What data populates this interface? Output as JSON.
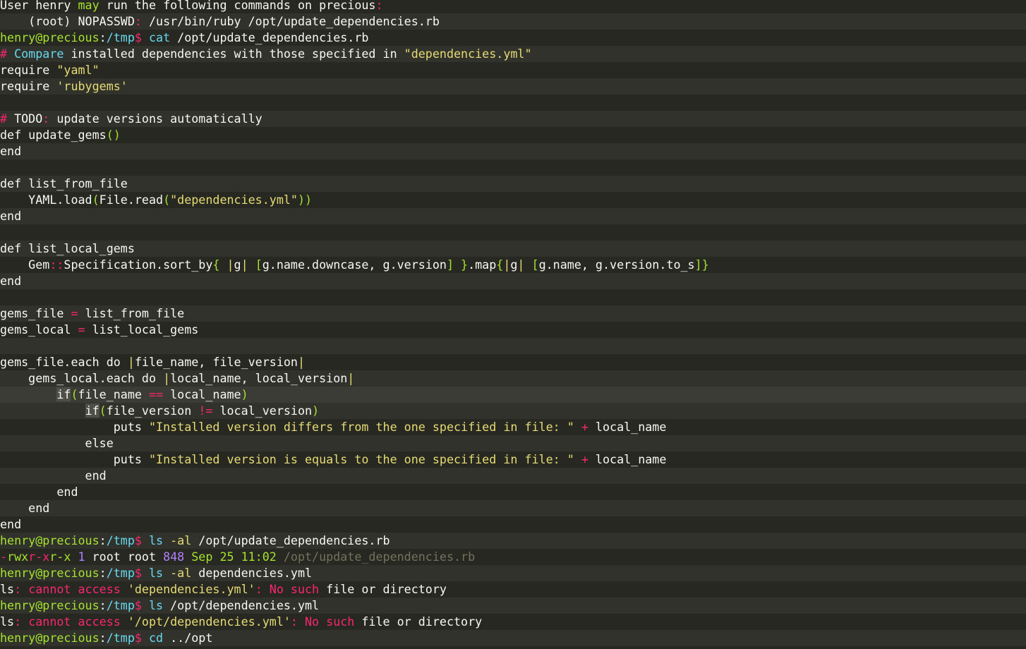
{
  "terminal": {
    "lines": [
      {
        "name": "sudo-l-header",
        "segs": [
          [
            "d",
            "User henry "
          ],
          [
            "g",
            "may"
          ],
          [
            "d",
            " run the following commands on precious"
          ],
          [
            "k",
            ":"
          ]
        ]
      },
      {
        "name": "sudo-l-entry",
        "segs": [
          [
            "d",
            "    (root) NOPASSWD"
          ],
          [
            "k",
            ":"
          ],
          [
            "d",
            " /usr/bin/ruby /opt/update_dependencies.rb"
          ]
        ]
      },
      {
        "name": "prompt-cat",
        "segs": [
          [
            "g",
            "henry@precious"
          ],
          [
            "d",
            ":"
          ],
          [
            "b",
            "/tmp"
          ],
          [
            "k",
            "$"
          ],
          [
            "d",
            " "
          ],
          [
            "b",
            "cat"
          ],
          [
            "d",
            " /opt/update_dependencies.rb"
          ]
        ]
      },
      {
        "name": "code-comment",
        "segs": [
          [
            "k",
            "#"
          ],
          [
            "d",
            " "
          ],
          [
            "b",
            "Compare"
          ],
          [
            "d",
            " installed dependencies with those specified in "
          ],
          [
            "y",
            "\"dependencies.yml\""
          ]
        ]
      },
      {
        "name": "code-require-yaml",
        "segs": [
          [
            "d",
            "require "
          ],
          [
            "y",
            "\"yaml\""
          ]
        ]
      },
      {
        "name": "code-require-rubygems",
        "segs": [
          [
            "d",
            "require "
          ],
          [
            "y",
            "'rubygems'"
          ]
        ]
      },
      {
        "name": "blank",
        "segs": []
      },
      {
        "name": "code-todo",
        "segs": [
          [
            "k",
            "#"
          ],
          [
            "d",
            " TODO"
          ],
          [
            "k",
            ":"
          ],
          [
            "d",
            " update versions automatically"
          ]
        ]
      },
      {
        "name": "code-def-update-gems",
        "segs": [
          [
            "d",
            "def update_gems"
          ],
          [
            "g",
            "()"
          ]
        ]
      },
      {
        "name": "code-end",
        "segs": [
          [
            "d",
            "end"
          ]
        ]
      },
      {
        "name": "blank",
        "segs": []
      },
      {
        "name": "code-def-list-from-file",
        "segs": [
          [
            "d",
            "def list_from_file"
          ]
        ]
      },
      {
        "name": "code-yaml-load",
        "segs": [
          [
            "d",
            "    YAML.load"
          ],
          [
            "g",
            "("
          ],
          [
            "d",
            "File.read"
          ],
          [
            "g",
            "("
          ],
          [
            "y",
            "\"dependencies.yml\""
          ],
          [
            "g",
            "))"
          ]
        ]
      },
      {
        "name": "code-end",
        "segs": [
          [
            "d",
            "end"
          ]
        ]
      },
      {
        "name": "blank",
        "segs": []
      },
      {
        "name": "code-def-list-local-gems",
        "segs": [
          [
            "d",
            "def list_local_gems"
          ]
        ]
      },
      {
        "name": "code-gem-spec",
        "segs": [
          [
            "d",
            "    Gem"
          ],
          [
            "k",
            "::"
          ],
          [
            "d",
            "Specification.sort_by"
          ],
          [
            "g",
            "{"
          ],
          [
            "d",
            " "
          ],
          [
            "y",
            "|"
          ],
          [
            "d",
            "g"
          ],
          [
            "y",
            "|"
          ],
          [
            "d",
            " "
          ],
          [
            "g",
            "["
          ],
          [
            "d",
            "g.name.downcase, g.version"
          ],
          [
            "g",
            "]"
          ],
          [
            "d",
            " "
          ],
          [
            "g",
            "}"
          ],
          [
            "d",
            ".map"
          ],
          [
            "g",
            "{"
          ],
          [
            "y",
            "|"
          ],
          [
            "d",
            "g"
          ],
          [
            "y",
            "|"
          ],
          [
            "d",
            " "
          ],
          [
            "g",
            "["
          ],
          [
            "d",
            "g.name, g.version.to_s"
          ],
          [
            "g",
            "]}"
          ]
        ]
      },
      {
        "name": "code-end",
        "segs": [
          [
            "d",
            "end"
          ]
        ]
      },
      {
        "name": "blank",
        "segs": []
      },
      {
        "name": "code-gems-file",
        "segs": [
          [
            "d",
            "gems_file "
          ],
          [
            "k",
            "="
          ],
          [
            "d",
            " list_from_file"
          ]
        ]
      },
      {
        "name": "code-gems-local",
        "segs": [
          [
            "d",
            "gems_local "
          ],
          [
            "k",
            "="
          ],
          [
            "d",
            " list_local_gems"
          ]
        ]
      },
      {
        "name": "blank",
        "segs": []
      },
      {
        "name": "code-each-file",
        "segs": [
          [
            "d",
            "gems_file.each do "
          ],
          [
            "y",
            "|"
          ],
          [
            "d",
            "file_name, file_version"
          ],
          [
            "y",
            "|"
          ]
        ]
      },
      {
        "name": "code-each-local",
        "segs": [
          [
            "d",
            "    gems_local.each do "
          ],
          [
            "y",
            "|"
          ],
          [
            "d",
            "local_name, local_version"
          ],
          [
            "y",
            "|"
          ]
        ]
      },
      {
        "name": "code-if-name",
        "cursor": true,
        "segs": [
          [
            "d",
            "        "
          ],
          [
            "hl",
            "if"
          ],
          [
            "g",
            "("
          ],
          [
            "d",
            "file_name "
          ],
          [
            "k",
            "=="
          ],
          [
            "d",
            " local_name"
          ],
          [
            "g",
            ")"
          ]
        ]
      },
      {
        "name": "code-if-version",
        "segs": [
          [
            "d",
            "            "
          ],
          [
            "hl",
            "if"
          ],
          [
            "g",
            "("
          ],
          [
            "d",
            "file_version "
          ],
          [
            "k",
            "!="
          ],
          [
            "d",
            " local_version"
          ],
          [
            "g",
            ")"
          ]
        ]
      },
      {
        "name": "code-puts-differs",
        "segs": [
          [
            "d",
            "                puts "
          ],
          [
            "y",
            "\"Installed version differs from the one specified in file: \""
          ],
          [
            "d",
            " "
          ],
          [
            "k",
            "+"
          ],
          [
            "d",
            " local_name"
          ]
        ]
      },
      {
        "name": "code-else",
        "segs": [
          [
            "d",
            "            else"
          ]
        ]
      },
      {
        "name": "code-puts-equals",
        "segs": [
          [
            "d",
            "                puts "
          ],
          [
            "y",
            "\"Installed version is equals to the one specified in file: \""
          ],
          [
            "d",
            " "
          ],
          [
            "k",
            "+"
          ],
          [
            "d",
            " local_name"
          ]
        ]
      },
      {
        "name": "code-end",
        "segs": [
          [
            "d",
            "            end"
          ]
        ]
      },
      {
        "name": "code-end",
        "segs": [
          [
            "d",
            "        end"
          ]
        ]
      },
      {
        "name": "code-end",
        "segs": [
          [
            "d",
            "    end"
          ]
        ]
      },
      {
        "name": "code-end",
        "segs": [
          [
            "d",
            "end"
          ]
        ]
      },
      {
        "name": "prompt-ls-script",
        "segs": [
          [
            "g",
            "henry@precious"
          ],
          [
            "d",
            ":"
          ],
          [
            "b",
            "/tmp"
          ],
          [
            "k",
            "$"
          ],
          [
            "d",
            " "
          ],
          [
            "b",
            "ls"
          ],
          [
            "d",
            " "
          ],
          [
            "y",
            "-al"
          ],
          [
            "d",
            " /opt/update_dependencies.rb"
          ]
        ]
      },
      {
        "name": "ls-output",
        "segs": [
          [
            "k",
            "-"
          ],
          [
            "g",
            "rwx"
          ],
          [
            "k",
            "r-x"
          ],
          [
            "g",
            "r-x"
          ],
          [
            "d",
            " "
          ],
          [
            "p",
            "1"
          ],
          [
            "d",
            " root root "
          ],
          [
            "p",
            "848"
          ],
          [
            "d",
            " "
          ],
          [
            "g",
            "Sep 25 11:02"
          ],
          [
            "d",
            " "
          ],
          [
            "c",
            "/opt/update_dependencies.rb"
          ]
        ]
      },
      {
        "name": "prompt-ls-deps",
        "segs": [
          [
            "g",
            "henry@precious"
          ],
          [
            "d",
            ":"
          ],
          [
            "b",
            "/tmp"
          ],
          [
            "k",
            "$"
          ],
          [
            "d",
            " "
          ],
          [
            "b",
            "ls"
          ],
          [
            "d",
            " "
          ],
          [
            "y",
            "-al"
          ],
          [
            "d",
            " dependencies.yml"
          ]
        ]
      },
      {
        "name": "ls-error",
        "segs": [
          [
            "d",
            "ls"
          ],
          [
            "k",
            ":"
          ],
          [
            "d",
            " "
          ],
          [
            "k",
            "cannot"
          ],
          [
            "d",
            " "
          ],
          [
            "k",
            "access"
          ],
          [
            "d",
            " "
          ],
          [
            "y",
            "'dependencies.yml'"
          ],
          [
            "k",
            ":"
          ],
          [
            "d",
            " "
          ],
          [
            "k",
            "No"
          ],
          [
            "d",
            " "
          ],
          [
            "k",
            "such"
          ],
          [
            "d",
            " file or directory"
          ]
        ]
      },
      {
        "name": "prompt-ls-opt-deps",
        "segs": [
          [
            "g",
            "henry@precious"
          ],
          [
            "d",
            ":"
          ],
          [
            "b",
            "/tmp"
          ],
          [
            "k",
            "$"
          ],
          [
            "d",
            " "
          ],
          [
            "b",
            "ls"
          ],
          [
            "d",
            " /opt/dependencies.yml"
          ]
        ]
      },
      {
        "name": "ls-error",
        "segs": [
          [
            "d",
            "ls"
          ],
          [
            "k",
            ":"
          ],
          [
            "d",
            " "
          ],
          [
            "k",
            "cannot"
          ],
          [
            "d",
            " "
          ],
          [
            "k",
            "access"
          ],
          [
            "d",
            " "
          ],
          [
            "y",
            "'/opt/dependencies.yml'"
          ],
          [
            "k",
            ":"
          ],
          [
            "d",
            " "
          ],
          [
            "k",
            "No"
          ],
          [
            "d",
            " "
          ],
          [
            "k",
            "such"
          ],
          [
            "d",
            " file or directory"
          ]
        ]
      },
      {
        "name": "prompt-cd",
        "segs": [
          [
            "g",
            "henry@precious"
          ],
          [
            "d",
            ":"
          ],
          [
            "b",
            "/tmp"
          ],
          [
            "k",
            "$"
          ],
          [
            "d",
            " "
          ],
          [
            "b",
            "cd"
          ],
          [
            "d",
            " ../opt"
          ]
        ]
      }
    ]
  }
}
